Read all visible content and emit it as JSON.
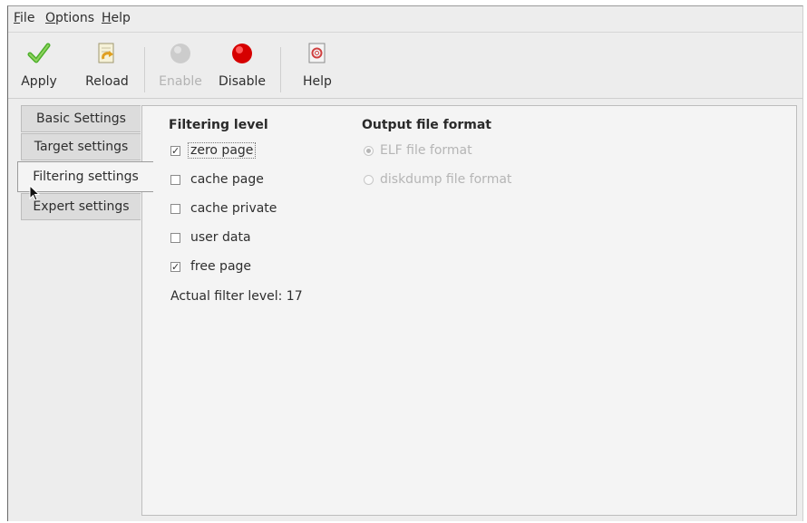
{
  "menu": {
    "file": "File",
    "options": "Options",
    "help": "Help"
  },
  "toolbar": {
    "apply": "Apply",
    "reload": "Reload",
    "enable": "Enable",
    "disable": "Disable",
    "help": "Help"
  },
  "tabs": [
    {
      "label": "Basic Settings"
    },
    {
      "label": "Target settings"
    },
    {
      "label": "Filtering settings"
    },
    {
      "label": "Expert settings"
    }
  ],
  "filtering": {
    "title": "Filtering level",
    "options": [
      {
        "label": "zero page",
        "checked": true
      },
      {
        "label": "cache page",
        "checked": false
      },
      {
        "label": "cache private",
        "checked": false
      },
      {
        "label": "user data",
        "checked": false
      },
      {
        "label": "free page",
        "checked": true
      }
    ],
    "actual_level": "Actual filter level: 17"
  },
  "output": {
    "title": "Output file format",
    "options": [
      {
        "label": "ELF file format",
        "selected": true
      },
      {
        "label": "diskdump file format",
        "selected": false
      }
    ]
  },
  "icons": {
    "apply": "checkmark-icon",
    "reload": "reload-icon",
    "enable": "enable-icon",
    "disable": "disable-icon",
    "help": "help-icon"
  },
  "colors": {
    "apply_green": "#4caf2a",
    "disable_red": "#d60000",
    "enable_gray": "#cccccc"
  }
}
